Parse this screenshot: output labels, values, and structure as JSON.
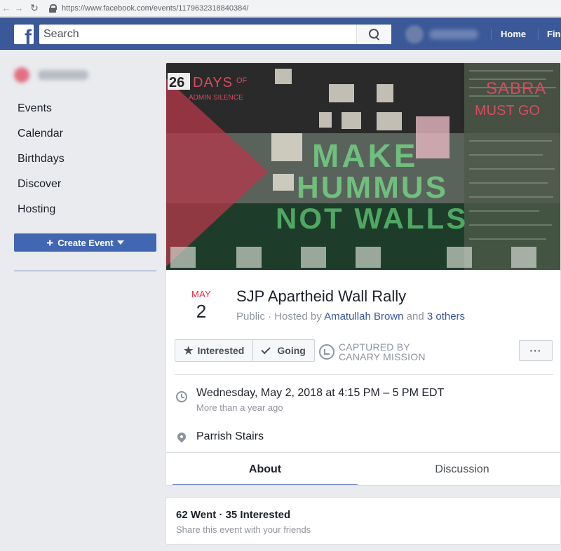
{
  "browser": {
    "url": "https://www.facebook.com/events/1179632318840384/"
  },
  "header": {
    "search_placeholder": "Search",
    "home_label": "Home",
    "find_label": "Fin"
  },
  "sidebar": {
    "items": [
      "Events",
      "Calendar",
      "Birthdays",
      "Discover",
      "Hosting"
    ],
    "create_label": "Create Event"
  },
  "event": {
    "month": "MAY",
    "day": "2",
    "title": "SJP Apartheid Wall Rally",
    "privacy": "Public",
    "hosted_by_prefix": " · Hosted by ",
    "host_name": "Amatullah Brown",
    "and_text": " and ",
    "others_text": "3 others",
    "interested_label": "Interested",
    "going_label": "Going",
    "watermark_line1": "CAPTURED BY",
    "watermark_line2": "CANARY MISSION",
    "more_label": "···",
    "when_main": "Wednesday, May 2, 2018 at 4:15 PM – 5 PM EDT",
    "when_sub": "More than a year ago",
    "location": "Parrish Stairs",
    "tabs": [
      "About",
      "Discussion"
    ],
    "cover_text": {
      "days": "26 DAYS",
      "of": "OF",
      "admin": "ADMIN SILENCE",
      "sabra": "SABRA",
      "must_go": "MUST GO",
      "make": "MAKE",
      "hummus": "HUMMUS",
      "not_walls": "NOT WALLS"
    }
  },
  "stats": {
    "main": "62 Went · 35 Interested",
    "sub": "Share this event with your friends"
  },
  "colors": {
    "fb_blue": "#3b5998",
    "button_blue": "#4267b2",
    "date_red": "#f02849",
    "link": "#365899"
  }
}
